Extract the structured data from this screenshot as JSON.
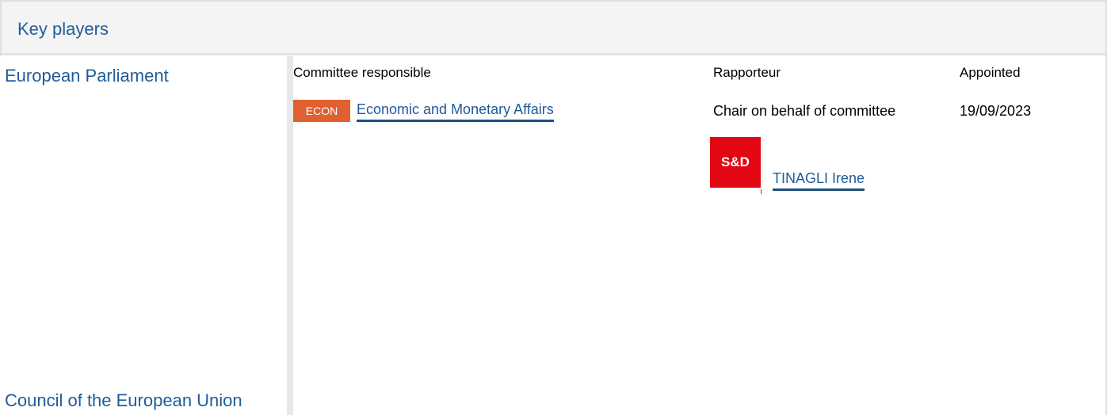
{
  "panel": {
    "title": "Key players"
  },
  "institutions": {
    "ep": "European Parliament",
    "council": "Council of the European Union"
  },
  "columns": {
    "committee": "Committee responsible",
    "rapporteur": "Rapporteur",
    "appointed": "Appointed"
  },
  "committee": {
    "badge": "ECON",
    "name": "Economic and Monetary Affairs",
    "rapporteur_role": "Chair on behalf of committee",
    "appointed": "19/09/2023"
  },
  "member": {
    "group_logo_text": "S&D",
    "name": "TINAGLI Irene"
  },
  "colors": {
    "link": "#1f5c99",
    "econ_badge": "#e06030",
    "sd_red": "#e30613"
  }
}
